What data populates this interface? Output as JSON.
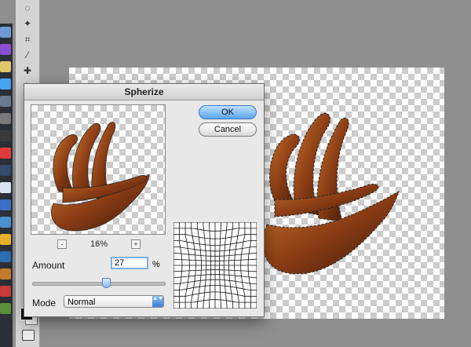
{
  "dialog": {
    "title": "Spherize",
    "ok_label": "OK",
    "cancel_label": "Cancel",
    "zoom_out_label": "-",
    "zoom_in_label": "+",
    "zoom_value": "16%",
    "amount_label": "Amount",
    "amount_value": "27",
    "amount_unit": "%",
    "amount_slider_fraction": 0.55,
    "mode_label": "Mode",
    "mode_value": "Normal",
    "mode_arrow": "▲▼"
  },
  "tools": [
    "lasso-icon",
    "magic-wand-icon",
    "crop-icon",
    "eyedropper-icon",
    "healing-brush-icon",
    "brush-icon",
    "stamp-icon",
    "history-brush-icon",
    "eraser-icon",
    "gradient-icon",
    "blur-icon",
    "dodge-icon",
    "pen-icon",
    "type-icon",
    "path-select-icon",
    "shape-icon",
    "hand-icon",
    "zoom-icon"
  ],
  "dock": [
    {
      "icon": "folder-icon",
      "color": "#6f9ad6"
    },
    {
      "icon": "purple-app-icon",
      "color": "#8a4fd2"
    },
    {
      "icon": "note-icon",
      "color": "#e2c66a"
    },
    {
      "icon": "music-icon",
      "color": "#4aa3f0"
    },
    {
      "icon": "app-icon",
      "color": "#6a7b8e"
    },
    {
      "icon": "settings-icon",
      "color": "#7a7a7a"
    },
    {
      "icon": "camera-icon",
      "color": "#3a3a3a"
    },
    {
      "icon": "calendar-icon",
      "color": "#e23b3b"
    },
    {
      "icon": "lightroom-icon",
      "color": "#334b6e"
    },
    {
      "icon": "finder-icon",
      "color": "#d9e4f2"
    },
    {
      "icon": "word-icon",
      "color": "#3b6fc4"
    },
    {
      "icon": "key-icon",
      "color": "#4a90d0"
    },
    {
      "icon": "chrome-icon",
      "color": "#e8b128"
    },
    {
      "icon": "photoshop-icon",
      "color": "#2b6fb3"
    },
    {
      "icon": "app-icon",
      "color": "#c47a2c"
    },
    {
      "icon": "acrobat-icon",
      "color": "#c83b3b"
    },
    {
      "icon": "app-icon",
      "color": "#5a8f3c"
    }
  ],
  "colors": {
    "accent": "#5aa5ee",
    "object_dark": "#3a1a0a",
    "object_mid": "#8a3c14",
    "object_light": "#c8742e"
  }
}
